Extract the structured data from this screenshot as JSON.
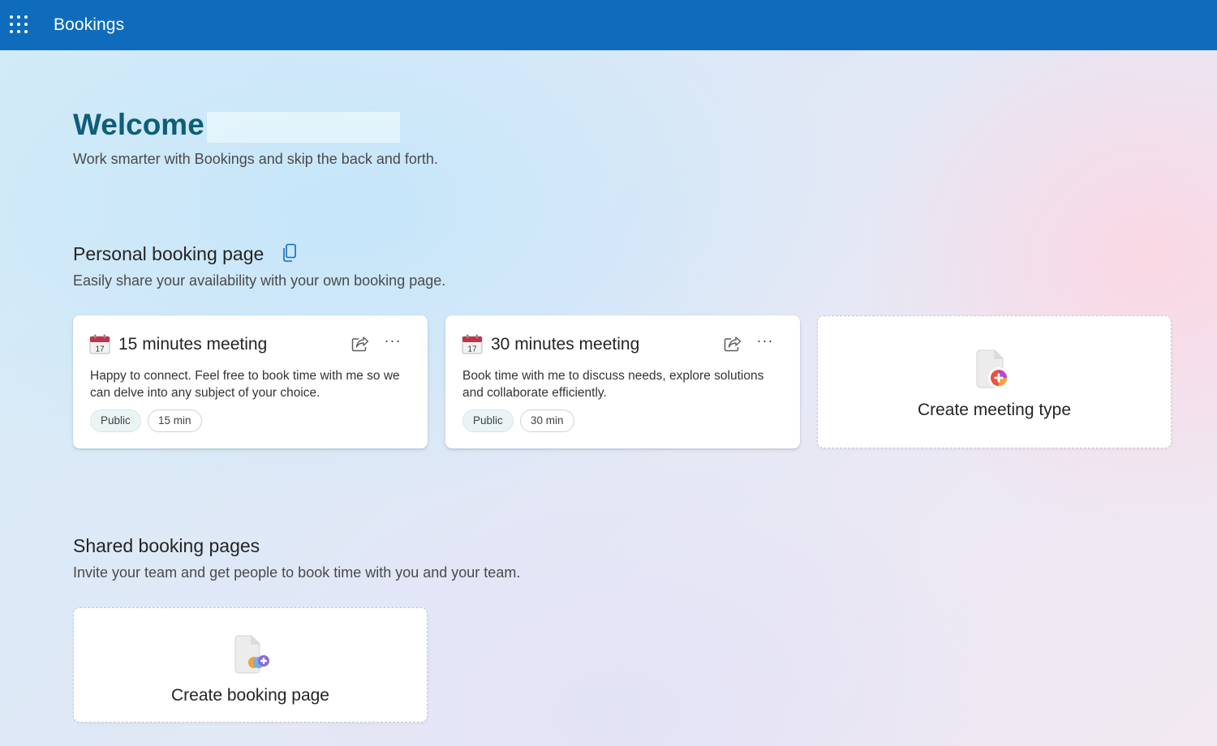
{
  "header": {
    "app_title": "Bookings",
    "icon": "app-launcher-icon",
    "background_color": "#0f6cbd"
  },
  "welcome": {
    "title": "Welcome",
    "subtitle": "Work smarter with Bookings and skip the back and forth."
  },
  "personal": {
    "title": "Personal booking page",
    "subtitle": "Easily share your availability with your own booking page.",
    "copy_icon": "copy-icon",
    "meetings": [
      {
        "title": "15 minutes meeting",
        "calendar_day": "17",
        "description": "Happy to connect. Feel free to book time with me so we can delve into any subject of your choice.",
        "visibility": "Public",
        "duration": "15 min",
        "more_label": "···"
      },
      {
        "title": "30 minutes meeting",
        "calendar_day": "17",
        "description": "Book time with me to discuss needs, explore solutions and collaborate efficiently.",
        "visibility": "Public",
        "duration": "30 min",
        "more_label": "···"
      }
    ],
    "create_label": "Create meeting type"
  },
  "shared": {
    "title": "Shared booking pages",
    "subtitle": "Invite your team and get people to book time with you and your team.",
    "create_label": "Create booking page"
  }
}
